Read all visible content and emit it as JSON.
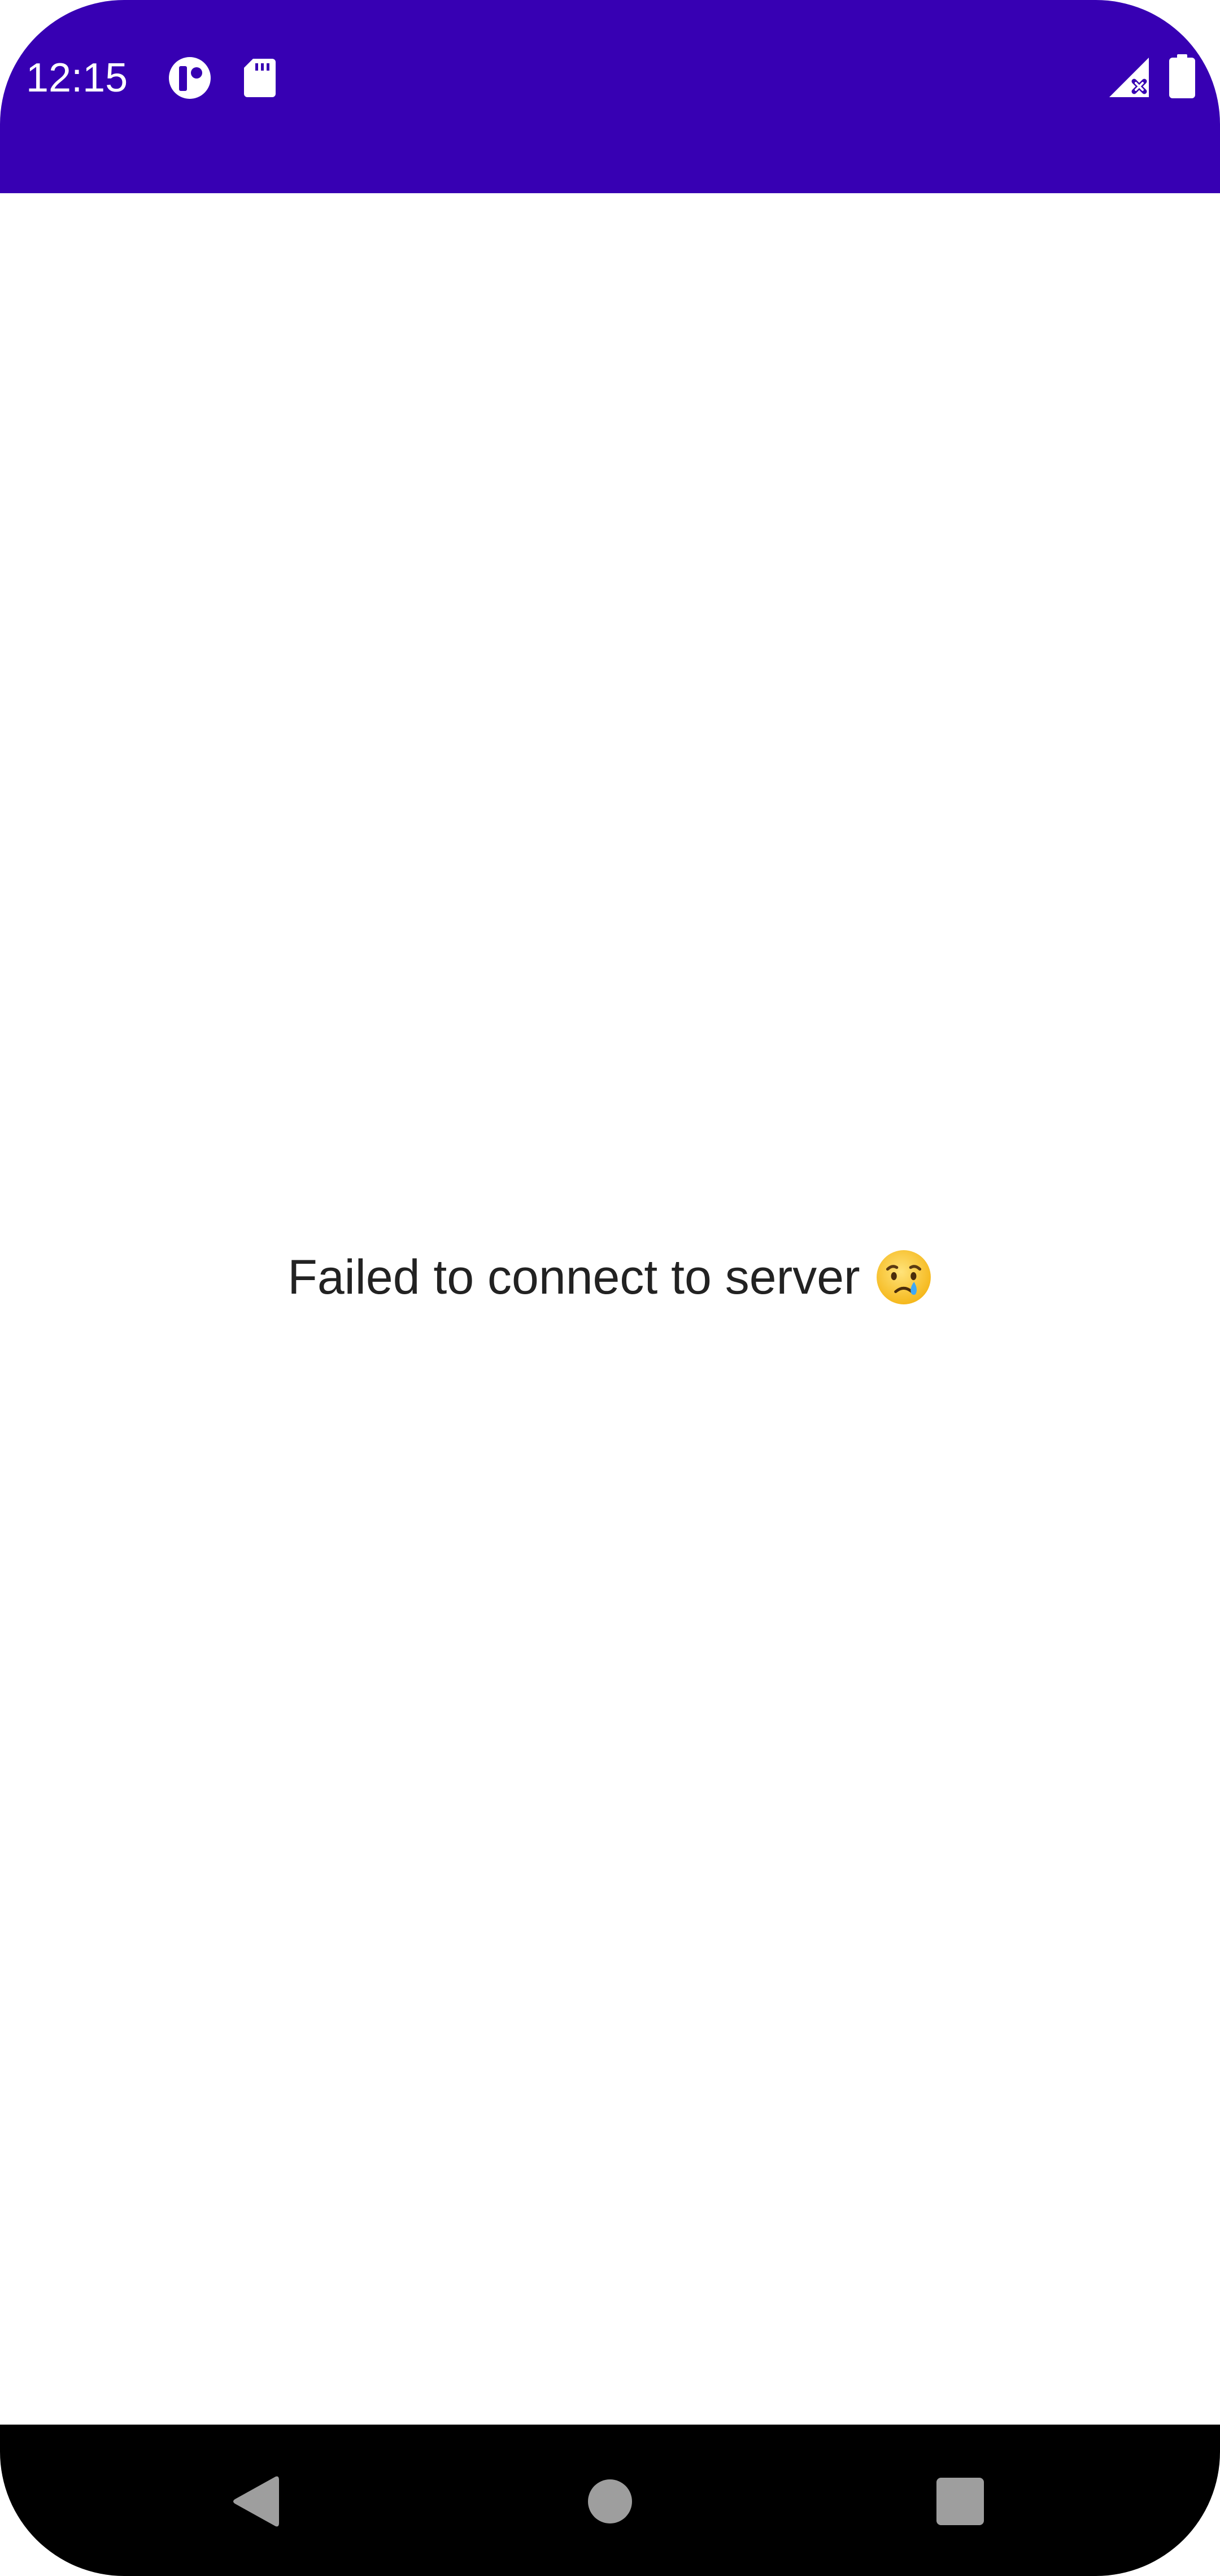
{
  "status_bar": {
    "time": "12:15",
    "background_color": "#3700b3",
    "icons_left": [
      "app-notification-icon",
      "sd-card-icon"
    ],
    "icons_right": [
      "signal-no-service-icon",
      "battery-icon"
    ]
  },
  "main": {
    "message": "Failed to connect to server",
    "emoji_icon": "crying-face-icon"
  },
  "nav_bar": {
    "buttons": [
      "back-icon",
      "home-icon",
      "recents-icon"
    ]
  }
}
